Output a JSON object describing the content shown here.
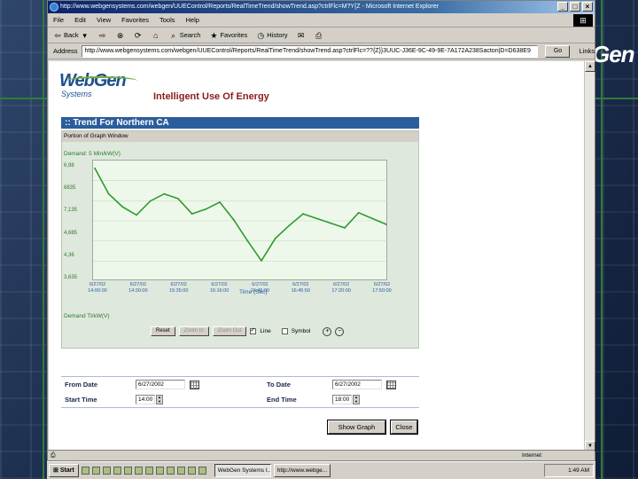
{
  "slide": {
    "brand_fragment": "Gen"
  },
  "window": {
    "title": "http://www.webgensystems.com/webgen/UUEControl/Reports/RealTimeTrend/showTrend.asp?ctrlFlc=M?Y{Z - Microsoft Internet Explorer",
    "controls": [
      "_",
      "□",
      "×"
    ]
  },
  "menu": [
    "File",
    "Edit",
    "View",
    "Favorites",
    "Tools",
    "Help"
  ],
  "toolbar": {
    "back": "Back",
    "search": "Search",
    "favorites": "Favorites",
    "history": "History"
  },
  "address": {
    "label": "Address",
    "url": "http://www.webgensystems.com/webgen/UUEControl/Reports/RealTimeTrend/showTrend.asp?ctrlFlc=??{Z}}3UUC-J36E-9C-49-9E-7A172A238Sacton|D=D638E9",
    "go": "Go",
    "links": "Links"
  },
  "page": {
    "logo_main": "WebGen",
    "logo_sub": "Systems",
    "tagline": "Intelligent Use Of Energy",
    "trend_title": ":: Trend For Northern CA",
    "portion_label": "Portion of Graph Window",
    "y_label": "Demand: 5 Min/kW(V)",
    "x_label": "Time (Sec)",
    "demand_label": "Demand Tl/kW(V)",
    "controls": {
      "reset": "Reset",
      "zoom_in": "Zoom In",
      "zoom_out": "Zoom Out",
      "line": "Line",
      "symbol": "Symbol"
    },
    "form": {
      "from_date_label": "From Date",
      "from_date_value": "6/27/2002",
      "to_date_label": "To Date",
      "to_date_value": "6/27/2002",
      "start_time_label": "Start Time",
      "start_time_value": "14:00",
      "end_time_label": "End Time",
      "end_time_value": "18:00"
    },
    "show_graph": "Show Graph",
    "close": "Close"
  },
  "status": {
    "zone": "Internet"
  },
  "taskbar": {
    "start": "Start",
    "tasks": [
      "WebGen Systems I...",
      "http://www.webge..."
    ],
    "clock": "1:49 AM"
  },
  "chart_data": {
    "type": "line",
    "title": "",
    "ylabel": "Demand: 5 Min/kW(V)",
    "xlabel": "Time (Sec)",
    "y_ticks": [
      "6,98",
      "6835",
      "7,135",
      "4,685",
      "4,36",
      "3,635"
    ],
    "x_ticks": [
      "6/27/02 14:00:00",
      "6/27/02 14:30:00",
      "6/27/02 15:35:00",
      "6/27/02 16:16:00",
      "6/27/02 16:45:00",
      "6/27/02 16:45:50",
      "6/27/02 17:20:00",
      "6/27/02 17:50:00"
    ],
    "ylim": [
      0,
      100
    ],
    "grid": true,
    "series": [
      {
        "values": [
          95,
          73,
          62,
          55,
          67,
          73,
          69,
          56,
          60,
          66,
          51,
          33,
          16,
          35,
          46,
          56,
          52,
          48,
          44,
          57,
          52,
          47
        ]
      }
    ],
    "colors": {
      "line": "#2e9a2e"
    }
  }
}
